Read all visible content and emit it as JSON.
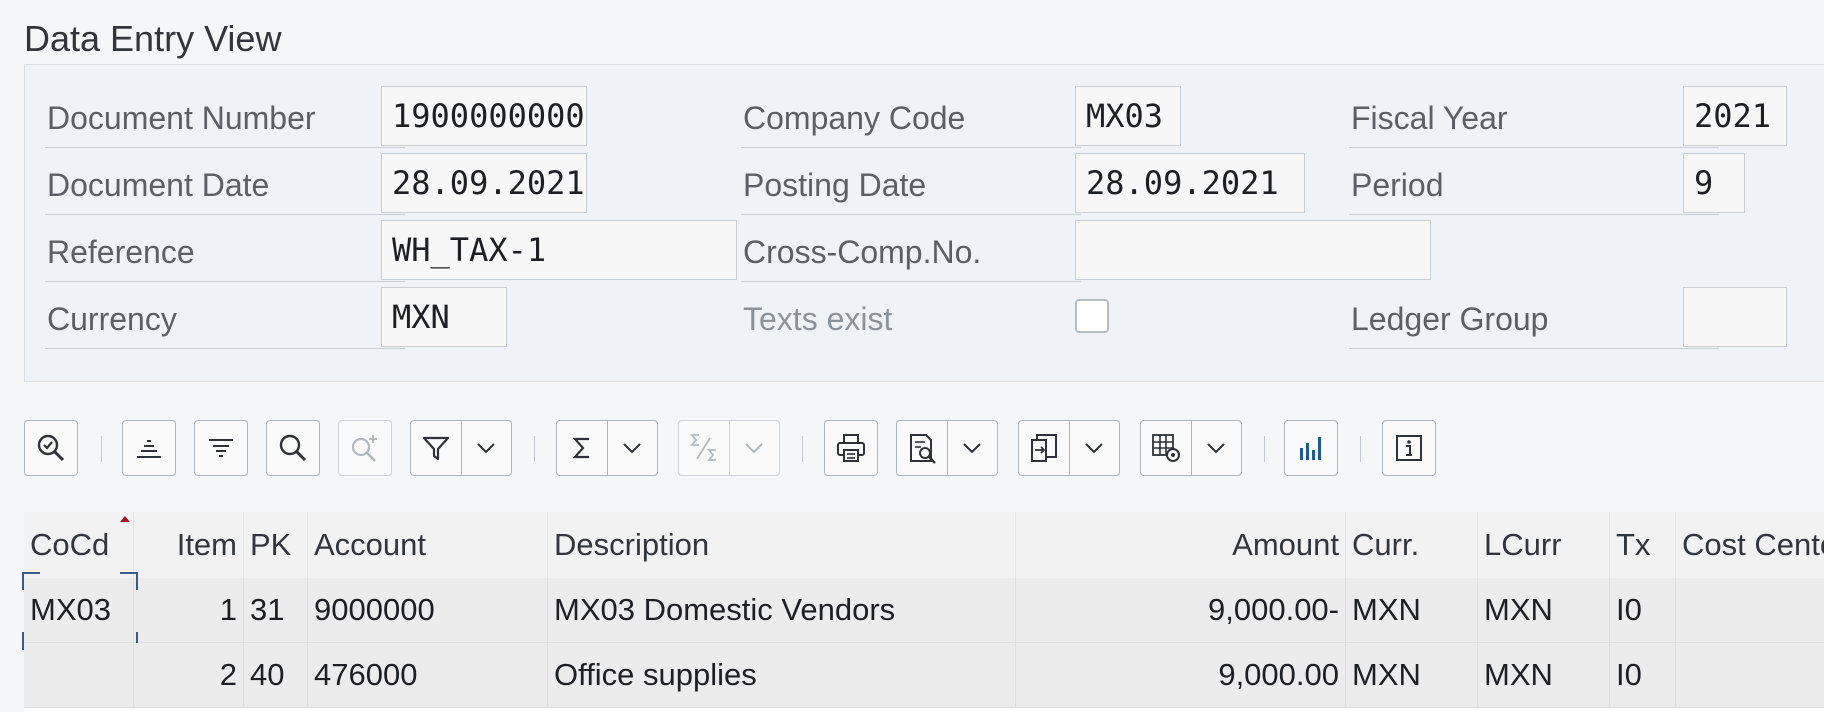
{
  "section_title": "Data Entry View",
  "header": {
    "document_number": {
      "label": "Document Number",
      "value": "1900000000"
    },
    "company_code": {
      "label": "Company Code",
      "value": "MX03"
    },
    "fiscal_year": {
      "label": "Fiscal Year",
      "value": "2021"
    },
    "document_date": {
      "label": "Document Date",
      "value": "28.09.2021"
    },
    "posting_date": {
      "label": "Posting Date",
      "value": "28.09.2021"
    },
    "period": {
      "label": "Period",
      "value": "9"
    },
    "reference": {
      "label": "Reference",
      "value": "WH_TAX-1"
    },
    "cross_comp": {
      "label": "Cross-Comp.No.",
      "value": ""
    },
    "currency": {
      "label": "Currency",
      "value": "MXN"
    },
    "texts_exist": {
      "label": "Texts exist",
      "checked": false
    },
    "ledger_group": {
      "label": "Ledger Group",
      "value": ""
    }
  },
  "toolbar": {
    "buttons": [
      "details-icon",
      "sort-ascending-icon",
      "sort-descending-icon",
      "search-icon",
      "search-next-icon",
      "filter-icon",
      "sum-icon",
      "subtotal-icon",
      "print-icon",
      "view-icon",
      "export-icon",
      "layout-settings-icon",
      "chart-icon",
      "info-icon"
    ]
  },
  "table": {
    "columns": [
      "CoCd",
      "Item",
      "PK",
      "Account",
      "Description",
      "Amount",
      "Curr.",
      "LCurr",
      "Tx",
      "Cost Center"
    ],
    "rows": [
      {
        "cocd": "MX03",
        "item": "1",
        "pk": "31",
        "account": "9000000",
        "description": "MX03 Domestic Vendors",
        "amount": "9,000.00-",
        "curr": "MXN",
        "lcurr": "MXN",
        "tx": "I0",
        "cost_center": ""
      },
      {
        "cocd": "",
        "item": "2",
        "pk": "40",
        "account": "476000",
        "description": "Office supplies",
        "amount": "9,000.00",
        "curr": "MXN",
        "lcurr": "MXN",
        "tx": "I0",
        "cost_center": ""
      }
    ]
  },
  "colors": {
    "panel_bg": "#eff3f8",
    "accent": "#3a5b8a",
    "sort_marker": "#a7122a"
  }
}
